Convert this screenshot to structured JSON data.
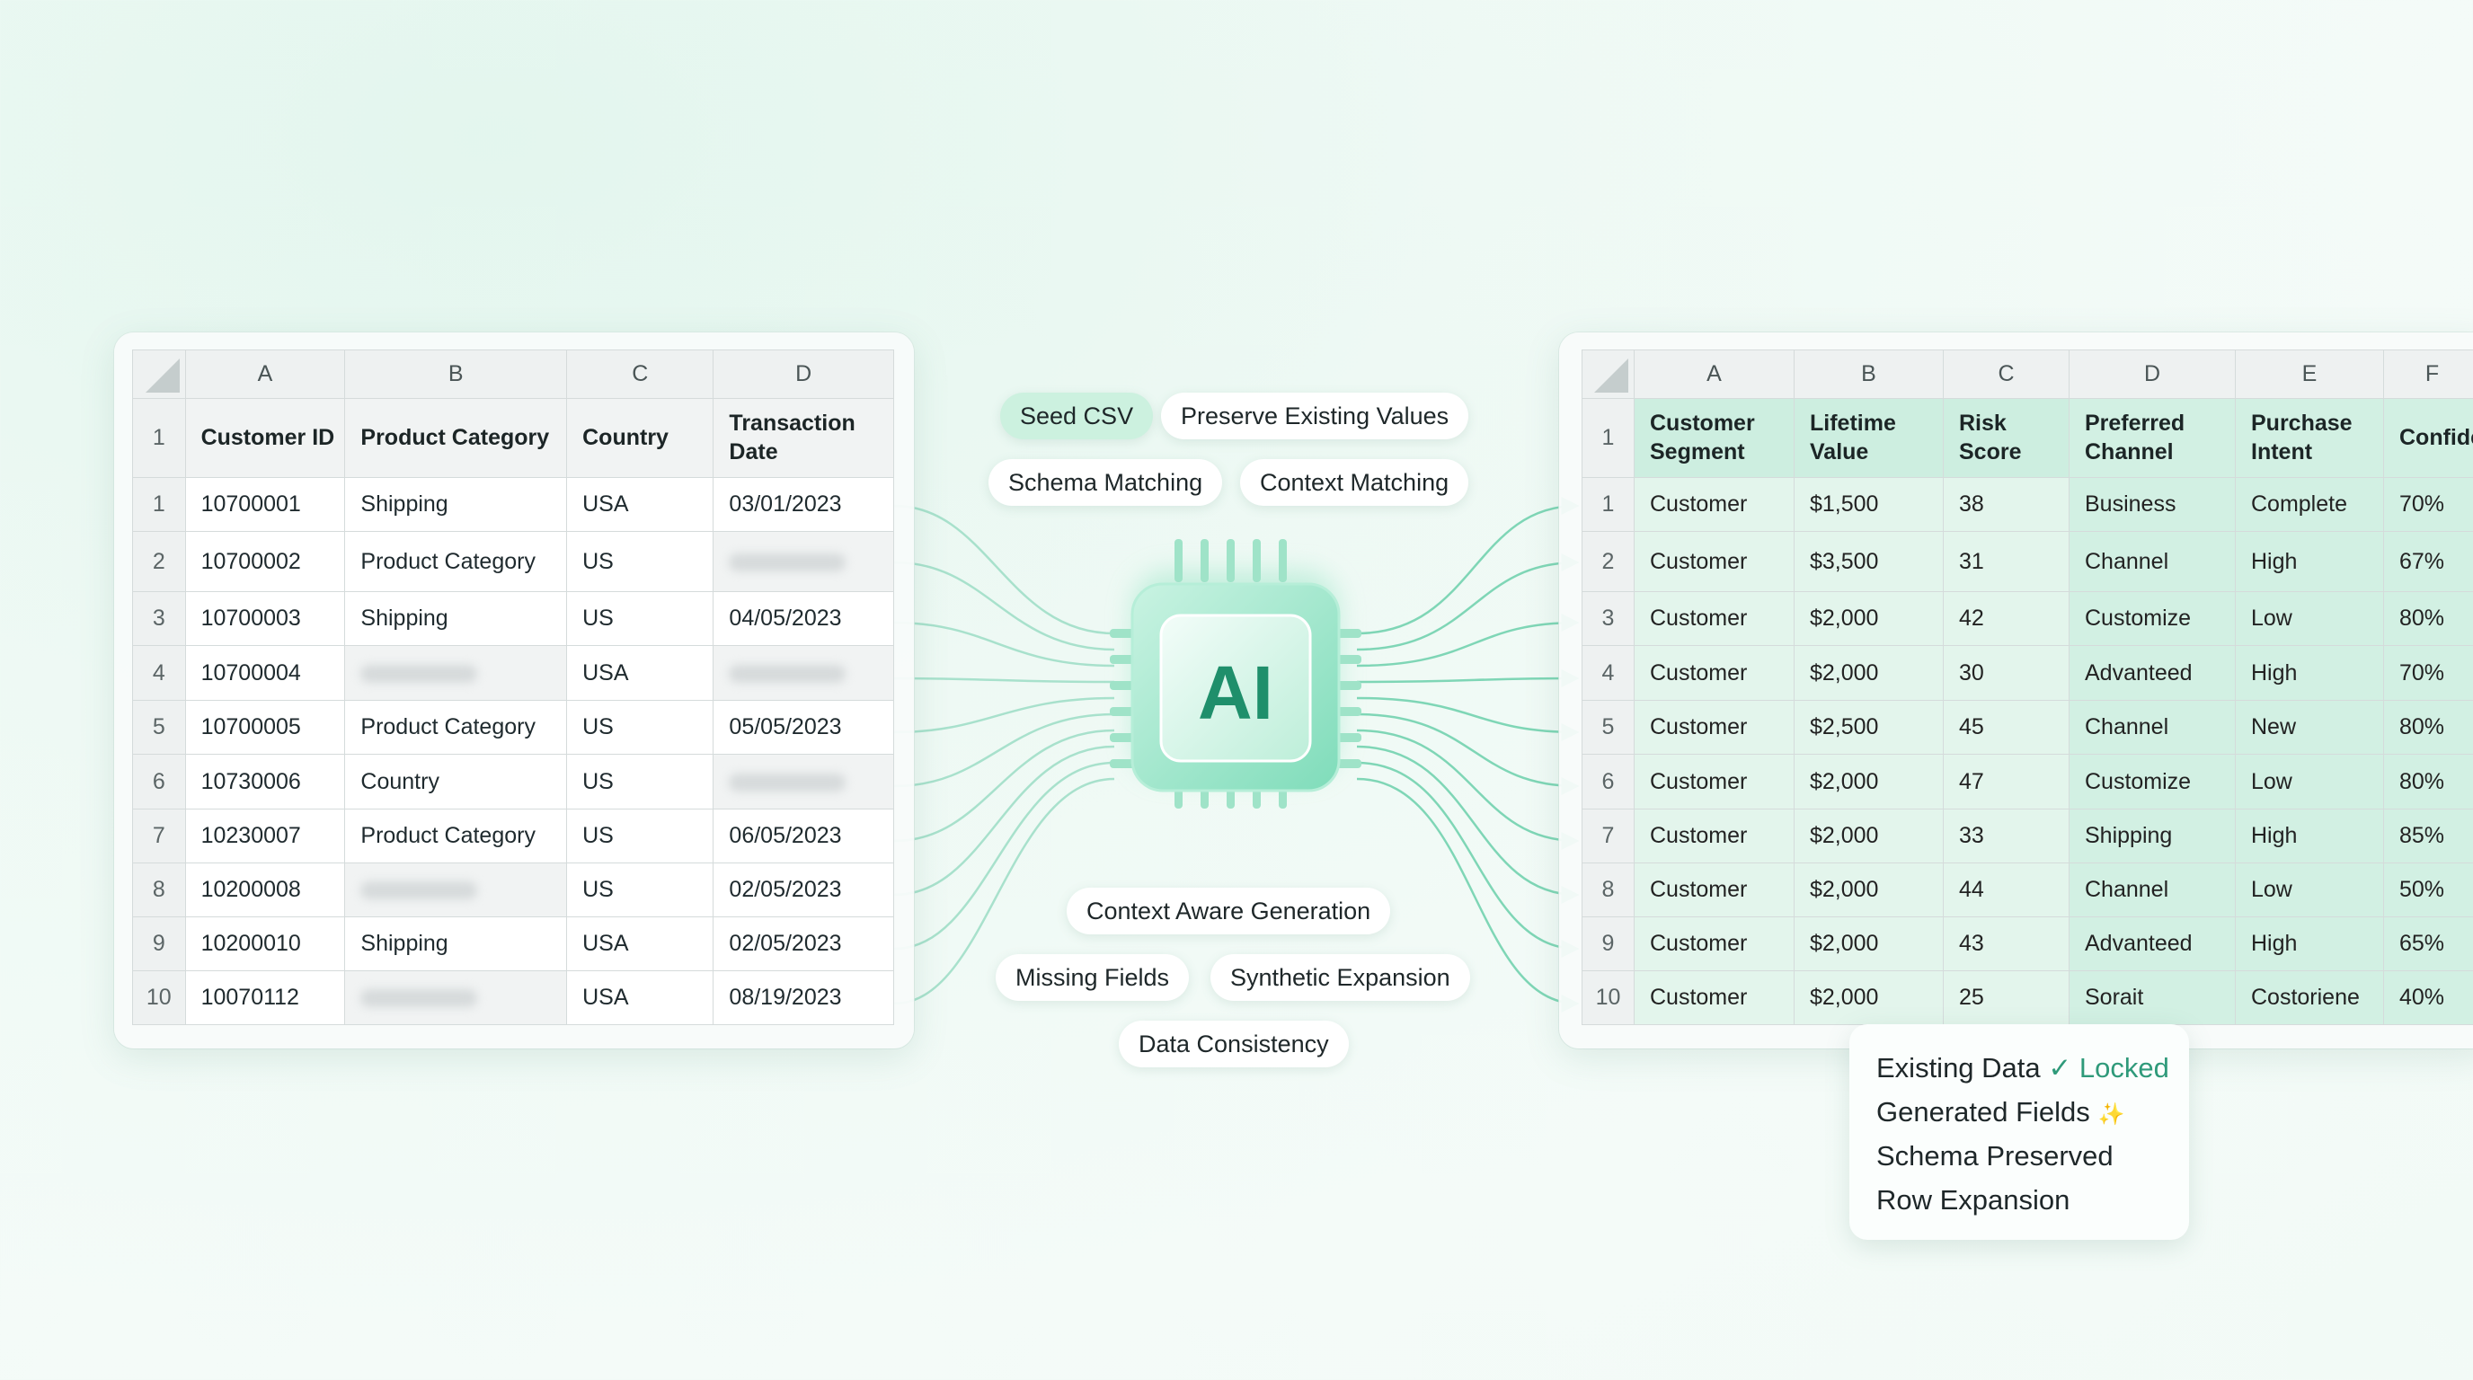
{
  "left_sheet": {
    "columns": [
      "A",
      "B",
      "C",
      "D"
    ],
    "headers": [
      "Customer ID",
      "Product Category",
      "Country",
      "Transaction Date"
    ],
    "rows": [
      {
        "n": "1",
        "cells": [
          "10700001",
          "Shipping",
          "USA",
          "03/01/2023"
        ]
      },
      {
        "n": "2",
        "cells": [
          "10700002",
          "Product Category",
          "US",
          ""
        ]
      },
      {
        "n": "3",
        "cells": [
          "10700003",
          "Shipping",
          "US",
          "04/05/2023"
        ]
      },
      {
        "n": "4",
        "cells": [
          "10700004",
          "",
          "USA",
          ""
        ]
      },
      {
        "n": "5",
        "cells": [
          "10700005",
          "Product Category",
          "US",
          "05/05/2023"
        ]
      },
      {
        "n": "6",
        "cells": [
          "10730006",
          "Country",
          "US",
          ""
        ]
      },
      {
        "n": "7",
        "cells": [
          "10230007",
          "Product Category",
          "US",
          "06/05/2023"
        ]
      },
      {
        "n": "8",
        "cells": [
          "10200008",
          "",
          "US",
          "02/05/2023"
        ]
      },
      {
        "n": "9",
        "cells": [
          "10200010",
          "Shipping",
          "USA",
          "02/05/2023"
        ]
      },
      {
        "n": "10",
        "cells": [
          "10070112",
          "",
          "USA",
          "08/19/2023"
        ]
      }
    ]
  },
  "right_sheet": {
    "columns": [
      "A",
      "B",
      "C",
      "D",
      "E",
      "F"
    ],
    "headers": [
      "Customer Segment",
      "Lifetime Value",
      "Risk Score",
      "Preferred Channel",
      "Purchase Intent",
      "Confide"
    ],
    "rows": [
      {
        "n": "1",
        "cells": [
          "Customer",
          "$1,500",
          "38",
          "Business",
          "Complete",
          "70%"
        ]
      },
      {
        "n": "2",
        "cells": [
          "Customer",
          "$3,500",
          "31",
          "Channel",
          "High",
          "67%"
        ]
      },
      {
        "n": "3",
        "cells": [
          "Customer",
          "$2,000",
          "42",
          "Customize",
          "Low",
          "80%"
        ]
      },
      {
        "n": "4",
        "cells": [
          "Customer",
          "$2,000",
          "30",
          "Advanteed",
          "High",
          "70%"
        ]
      },
      {
        "n": "5",
        "cells": [
          "Customer",
          "$2,500",
          "45",
          "Channel",
          "New",
          "80%"
        ]
      },
      {
        "n": "6",
        "cells": [
          "Customer",
          "$2,000",
          "47",
          "Customize",
          "Low",
          "80%"
        ]
      },
      {
        "n": "7",
        "cells": [
          "Customer",
          "$2,000",
          "33",
          "Shipping",
          "High",
          "85%"
        ]
      },
      {
        "n": "8",
        "cells": [
          "Customer",
          "$2,000",
          "44",
          "Channel",
          "Low",
          "50%"
        ]
      },
      {
        "n": "9",
        "cells": [
          "Customer",
          "$2,000",
          "43",
          "Advanteed",
          "High",
          "65%"
        ]
      },
      {
        "n": "10",
        "cells": [
          "Customer",
          "$2,000",
          "25",
          "Sorait",
          "Costoriene",
          "40%"
        ]
      }
    ]
  },
  "tags_top": {
    "seed_csv": "Seed CSV",
    "preserve_existing_values": "Preserve Existing Values",
    "schema_matching": "Schema Matching",
    "context_matching": "Context Matching"
  },
  "tags_bottom": {
    "context_aware_generation": "Context Aware Generation",
    "missing_fields": "Missing Fields",
    "synthetic_expansion": "Synthetic Expansion",
    "data_consistency": "Data Consistency"
  },
  "chip": {
    "label": "AI"
  },
  "legend": {
    "existing_data": "Existing Data",
    "check_glyph": "✓",
    "locked": "Locked",
    "generated_fields": "Generated Fields",
    "sparkle_glyph": "✨",
    "schema_preserved": "Schema Preserved",
    "row_expansion": "Row Expansion"
  },
  "colors": {
    "accent": "#2f9a7a",
    "chip": "#8fe3c4",
    "connector": "#8fd8bd"
  }
}
